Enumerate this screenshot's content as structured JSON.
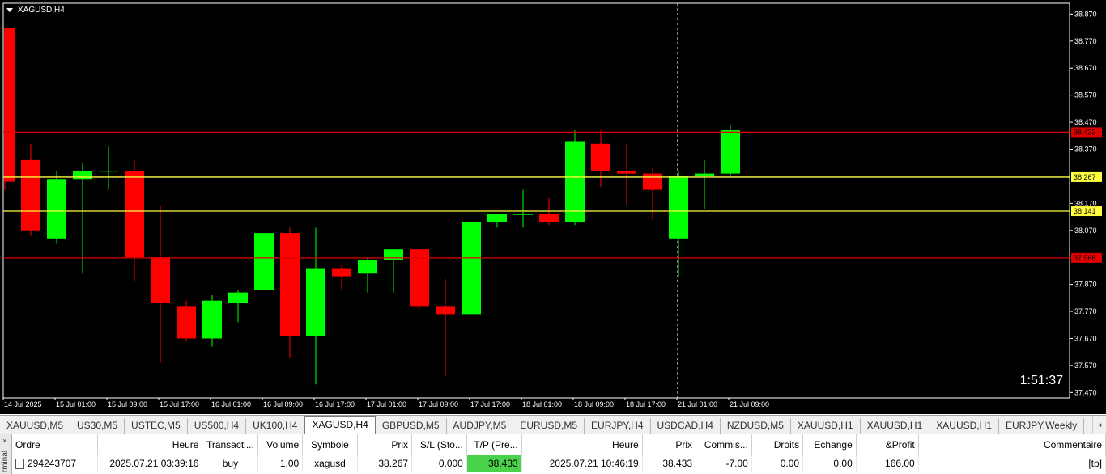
{
  "window": {
    "symbol_title": "XAGUSD,H4"
  },
  "chart": {
    "countdown": "1:51:37",
    "price_labels": [
      "38.870",
      "38.770",
      "38.670",
      "38.570",
      "38.470",
      "38.370",
      "38.170",
      "38.070",
      "37.870",
      "37.770",
      "37.670",
      "37.570",
      "37.470"
    ],
    "time_labels": [
      "14 Jul 2025",
      "15 Jul 01:00",
      "15 Jul 09:00",
      "15 Jul 17:00",
      "16 Jul 01:00",
      "16 Jul 09:00",
      "16 Jul 17:00",
      "17 Jul 01:00",
      "17 Jul 09:00",
      "17 Jul 17:00",
      "18 Jul 01:00",
      "18 Jul 09:00",
      "18 Jul 17:00",
      "21 Jul 01:00",
      "21 Jul 09:00"
    ],
    "hlines": [
      {
        "price": 38.433,
        "color": "#e00000",
        "label": "38.433"
      },
      {
        "price": 38.267,
        "color": "#ffff40",
        "label": "38.267"
      },
      {
        "price": 38.141,
        "color": "#ffff40",
        "label": "38.141"
      },
      {
        "price": 37.968,
        "color": "#e00000",
        "label": "37.968"
      }
    ],
    "bull_color": "#00ff00",
    "bear_color": "#ff0000",
    "candles": [
      {
        "o": 38.82,
        "h": 38.82,
        "l": 38.22,
        "c": 38.25
      },
      {
        "o": 38.33,
        "h": 38.39,
        "l": 38.05,
        "c": 38.07
      },
      {
        "o": 38.04,
        "h": 38.29,
        "l": 38.02,
        "c": 38.26
      },
      {
        "o": 38.26,
        "h": 38.32,
        "l": 37.91,
        "c": 38.29
      },
      {
        "o": 38.29,
        "h": 38.38,
        "l": 38.22,
        "c": 38.29
      },
      {
        "o": 38.29,
        "h": 38.33,
        "l": 37.88,
        "c": 37.97
      },
      {
        "o": 37.97,
        "h": 38.16,
        "l": 37.58,
        "c": 37.8
      },
      {
        "o": 37.79,
        "h": 37.81,
        "l": 37.66,
        "c": 37.67
      },
      {
        "o": 37.67,
        "h": 37.83,
        "l": 37.64,
        "c": 37.81
      },
      {
        "o": 37.8,
        "h": 37.85,
        "l": 37.73,
        "c": 37.84
      },
      {
        "o": 37.85,
        "h": 38.06,
        "l": 37.85,
        "c": 38.06
      },
      {
        "o": 38.06,
        "h": 38.08,
        "l": 37.6,
        "c": 37.68
      },
      {
        "o": 37.68,
        "h": 38.08,
        "l": 37.5,
        "c": 37.93
      },
      {
        "o": 37.93,
        "h": 37.94,
        "l": 37.85,
        "c": 37.9
      },
      {
        "o": 37.91,
        "h": 37.97,
        "l": 37.84,
        "c": 37.96
      },
      {
        "o": 37.96,
        "h": 37.99,
        "l": 37.84,
        "c": 38.0
      },
      {
        "o": 38.0,
        "h": 38.0,
        "l": 37.78,
        "c": 37.79
      },
      {
        "o": 37.79,
        "h": 37.89,
        "l": 37.53,
        "c": 37.76
      },
      {
        "o": 37.76,
        "h": 38.09,
        "l": 37.76,
        "c": 38.1
      },
      {
        "o": 38.1,
        "h": 38.12,
        "l": 38.08,
        "c": 38.13
      },
      {
        "o": 38.13,
        "h": 38.22,
        "l": 38.08,
        "c": 38.13
      },
      {
        "o": 38.13,
        "h": 38.19,
        "l": 38.09,
        "c": 38.1
      },
      {
        "o": 38.1,
        "h": 38.44,
        "l": 38.09,
        "c": 38.4
      },
      {
        "o": 38.39,
        "h": 38.44,
        "l": 38.23,
        "c": 38.29
      },
      {
        "o": 38.29,
        "h": 38.39,
        "l": 38.16,
        "c": 38.28
      },
      {
        "o": 38.28,
        "h": 38.3,
        "l": 38.11,
        "c": 38.22
      },
      {
        "o": 38.04,
        "h": 38.29,
        "l": 37.9,
        "c": 38.27
      },
      {
        "o": 38.27,
        "h": 38.33,
        "l": 38.15,
        "c": 38.28
      },
      {
        "o": 38.28,
        "h": 38.46,
        "l": 38.27,
        "c": 38.44
      }
    ],
    "y_range": [
      37.45,
      38.91
    ]
  },
  "tabs": [
    {
      "label": "XAUUSD,M5",
      "active": false
    },
    {
      "label": "US30,M5",
      "active": false
    },
    {
      "label": "USTEC,M5",
      "active": false
    },
    {
      "label": "US500,H4",
      "active": false
    },
    {
      "label": "UK100,H4",
      "active": false
    },
    {
      "label": "XAGUSD,H4",
      "active": true
    },
    {
      "label": "GBPUSD,M5",
      "active": false
    },
    {
      "label": "AUDJPY,M5",
      "active": false
    },
    {
      "label": "EURUSD,M5",
      "active": false
    },
    {
      "label": "EURJPY,H4",
      "active": false
    },
    {
      "label": "USDCAD,H4",
      "active": false
    },
    {
      "label": "NZDUSD,M5",
      "active": false
    },
    {
      "label": "XAUUSD,H1",
      "active": false
    },
    {
      "label": "XAUUSD,H1",
      "active": false
    },
    {
      "label": "XAUUSD,H1",
      "active": false
    },
    {
      "label": "EURJPY,Weekly",
      "active": false
    }
  ],
  "terminal": {
    "side_label": "rminal",
    "headers": [
      "Ordre",
      "Heure",
      "Transacti...",
      "Volume",
      "Symbole",
      "Prix",
      "S/L (Sto...",
      "T/P (Pre...",
      "Heure",
      "Prix",
      "Commis...",
      "Droits",
      "Echange",
      "&Profit",
      "Commentaire"
    ],
    "row": [
      "294243707",
      "2025.07.21 03:39:16",
      "buy",
      "1.00",
      "xagusd",
      "38.267",
      "0.000",
      "38.433",
      "2025.07.21 10:46:19",
      "38.433",
      "-7.00",
      "0.00",
      "0.00",
      "166.00",
      "[tp]"
    ]
  }
}
